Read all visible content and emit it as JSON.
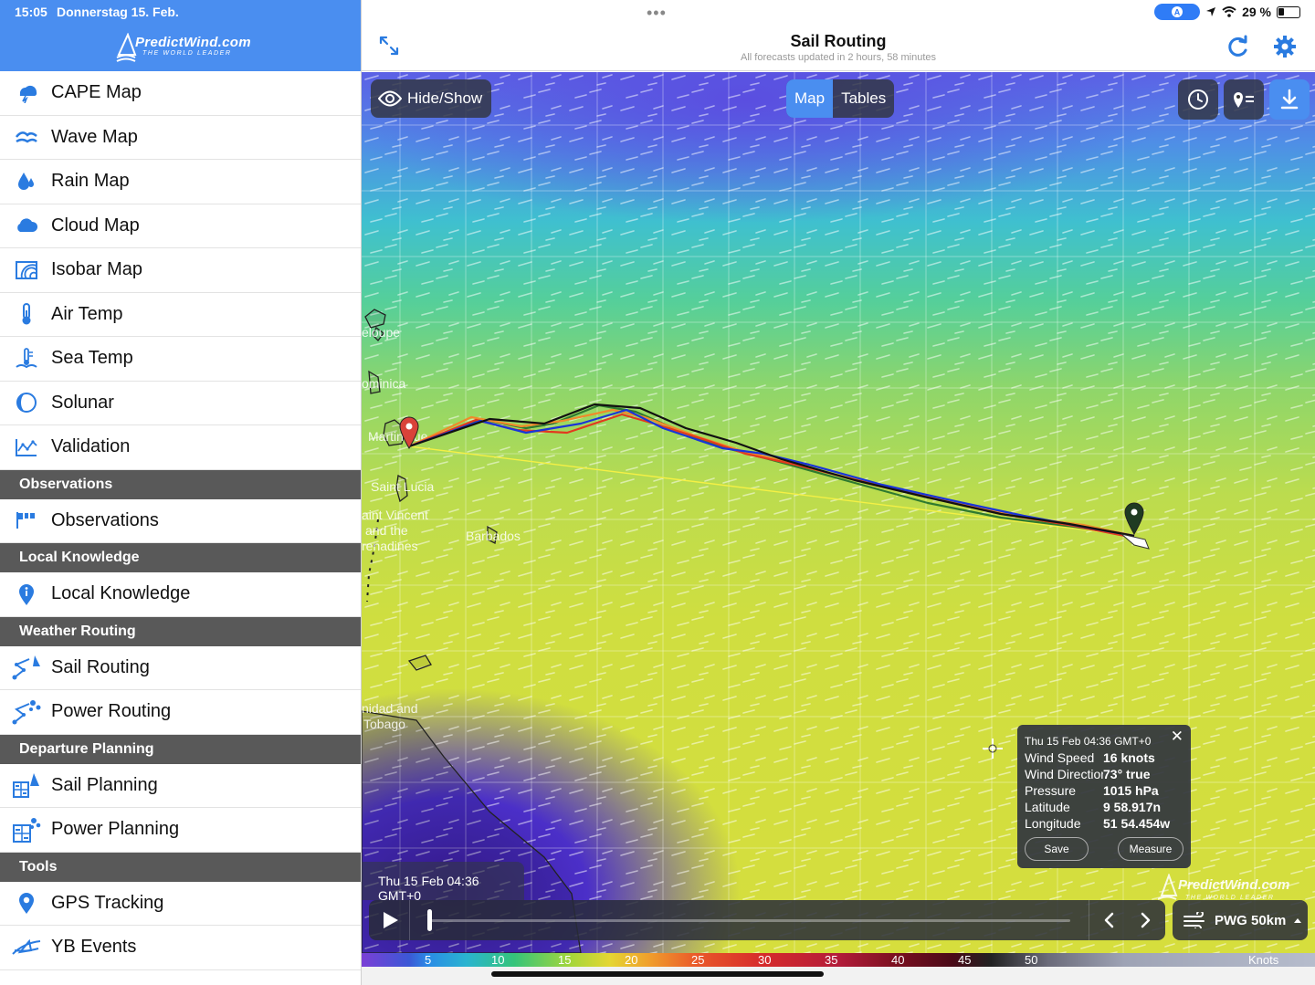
{
  "status_bar": {
    "time": "15:05",
    "date": "Donnerstag 15. Feb.",
    "battery": "29 %",
    "location_badge": "A"
  },
  "brand": {
    "name": "PredictWind.com",
    "tagline": "THE WORLD LEADER"
  },
  "menu": {
    "items_top": [
      {
        "label": "CAPE Map",
        "icon": "cape-map-icon"
      },
      {
        "label": "Wave Map",
        "icon": "wave-map-icon"
      },
      {
        "label": "Rain Map",
        "icon": "rain-map-icon"
      },
      {
        "label": "Cloud Map",
        "icon": "cloud-map-icon"
      },
      {
        "label": "Isobar Map",
        "icon": "isobar-map-icon"
      },
      {
        "label": "Air Temp",
        "icon": "thermometer-icon"
      },
      {
        "label": "Sea Temp",
        "icon": "sea-temp-icon"
      },
      {
        "label": "Solunar",
        "icon": "moon-icon"
      },
      {
        "label": "Validation",
        "icon": "validation-chart-icon"
      }
    ],
    "sections": [
      {
        "title": "Observations",
        "items": [
          {
            "label": "Observations",
            "icon": "flags-icon"
          }
        ]
      },
      {
        "title": "Local Knowledge",
        "items": [
          {
            "label": "Local Knowledge",
            "icon": "info-pin-icon"
          }
        ]
      },
      {
        "title": "Weather Routing",
        "items": [
          {
            "label": "Sail Routing",
            "icon": "sail-routing-icon"
          },
          {
            "label": "Power Routing",
            "icon": "power-routing-icon"
          }
        ]
      },
      {
        "title": "Departure Planning",
        "items": [
          {
            "label": "Sail Planning",
            "icon": "sail-planning-icon"
          },
          {
            "label": "Power Planning",
            "icon": "power-planning-icon"
          }
        ]
      },
      {
        "title": "Tools",
        "items": [
          {
            "label": "GPS Tracking",
            "icon": "gps-pin-icon"
          },
          {
            "label": "YB Events",
            "icon": "yb-events-icon"
          }
        ]
      }
    ]
  },
  "header": {
    "title": "Sail Routing",
    "subtitle": "All forecasts updated in 2 hours, 58 minutes"
  },
  "map": {
    "hide_show_label": "Hide/Show",
    "tabs": [
      {
        "label": "Map",
        "active": true
      },
      {
        "label": "Tables",
        "active": false
      }
    ],
    "place_labels": [
      "eloupe",
      "ominica",
      "Martinique",
      "Saint Lucia",
      "aint Vincent",
      "and the",
      "renadines",
      "Barbados",
      "nidad and",
      "Tobago"
    ],
    "route_colors": {
      "black": "#111111",
      "blue": "#1a35d8",
      "red": "#e23a1e",
      "orange": "#f08a2a",
      "green": "#2f7a2f",
      "yellow": "#f4f045"
    }
  },
  "popup": {
    "timestamp": "Thu 15 Feb 04:36 GMT+0",
    "rows": [
      {
        "key": "Wind Speed",
        "value": "16 knots"
      },
      {
        "key": "Wind Direction",
        "value": "73° true"
      },
      {
        "key": "Pressure",
        "value": "1015 hPa"
      },
      {
        "key": "Latitude",
        "value": "9 58.917n"
      },
      {
        "key": "Longitude",
        "value": "51 54.454w"
      }
    ],
    "save_label": "Save",
    "measure_label": "Measure"
  },
  "timeline": {
    "timestamp": "Thu 15 Feb 04:36 GMT+0",
    "model": "PWG 50km"
  },
  "scale": {
    "ticks": [
      "5",
      "10",
      "15",
      "20",
      "25",
      "30",
      "35",
      "40",
      "45",
      "50"
    ],
    "unit": "Knots"
  }
}
